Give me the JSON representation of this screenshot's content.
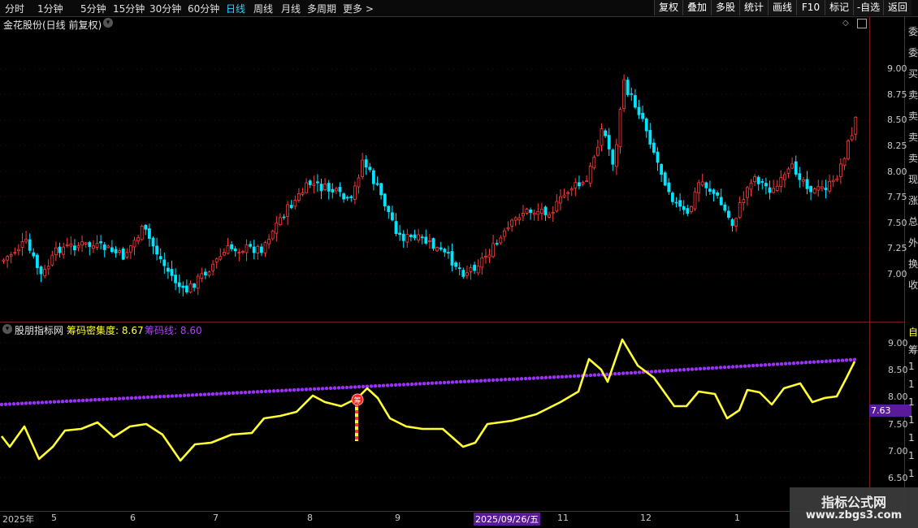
{
  "toolbar": {
    "periods": [
      "分时",
      "1分钟",
      "5分钟",
      "15分钟",
      "30分钟",
      "60分钟",
      "日线",
      "周线",
      "月线",
      "多周期",
      "更多 >"
    ],
    "active_period": "日线",
    "buttons": [
      "复权",
      "叠加",
      "多股",
      "统计",
      "画线",
      "F10",
      "标记",
      "-自选",
      "返回"
    ]
  },
  "main_panel": {
    "title": "金花股份(日线 前复权)",
    "y_ticks": [
      "9.00",
      "8.75",
      "8.50",
      "8.25",
      "8.00",
      "7.75",
      "7.50",
      "7.25",
      "7.00"
    ]
  },
  "indicator_panel": {
    "name": "股朋指标网",
    "series": [
      {
        "name": "筹码密集度",
        "value": "8.67",
        "color": "#ffff33"
      },
      {
        "name": "筹码线",
        "value": "8.60",
        "color": "#9b30ff"
      }
    ],
    "y_ticks": [
      "9.00",
      "8.50",
      "8.00",
      "7.50",
      "7.00",
      "6.50"
    ],
    "current_value_tag": "7.63",
    "signal_icon": "chip-signal-icon"
  },
  "x_axis": {
    "labels": [
      "2025年",
      "5",
      "6",
      "7",
      "8",
      "9",
      "2025/09/26/五",
      "11",
      "12",
      "1"
    ]
  },
  "colors": {
    "up": "#ff3a3a",
    "down": "#00e5ff",
    "density_line": "#ffff33",
    "chip_line": "#9b30ff",
    "border": "#7a1d1d"
  },
  "watermark": {
    "line1": "指标公式网",
    "line2": "www.zbgs3.com"
  },
  "right_strip": {
    "glyphs": [
      "委",
      "委",
      "买",
      "卖",
      "卖",
      "卖",
      "卖",
      "现",
      "涨",
      "总",
      "外",
      "换",
      "收"
    ],
    "ind_glyphs": [
      "自",
      "筹",
      "1",
      "1",
      "1",
      "1",
      "1",
      "1",
      "1"
    ]
  }
}
